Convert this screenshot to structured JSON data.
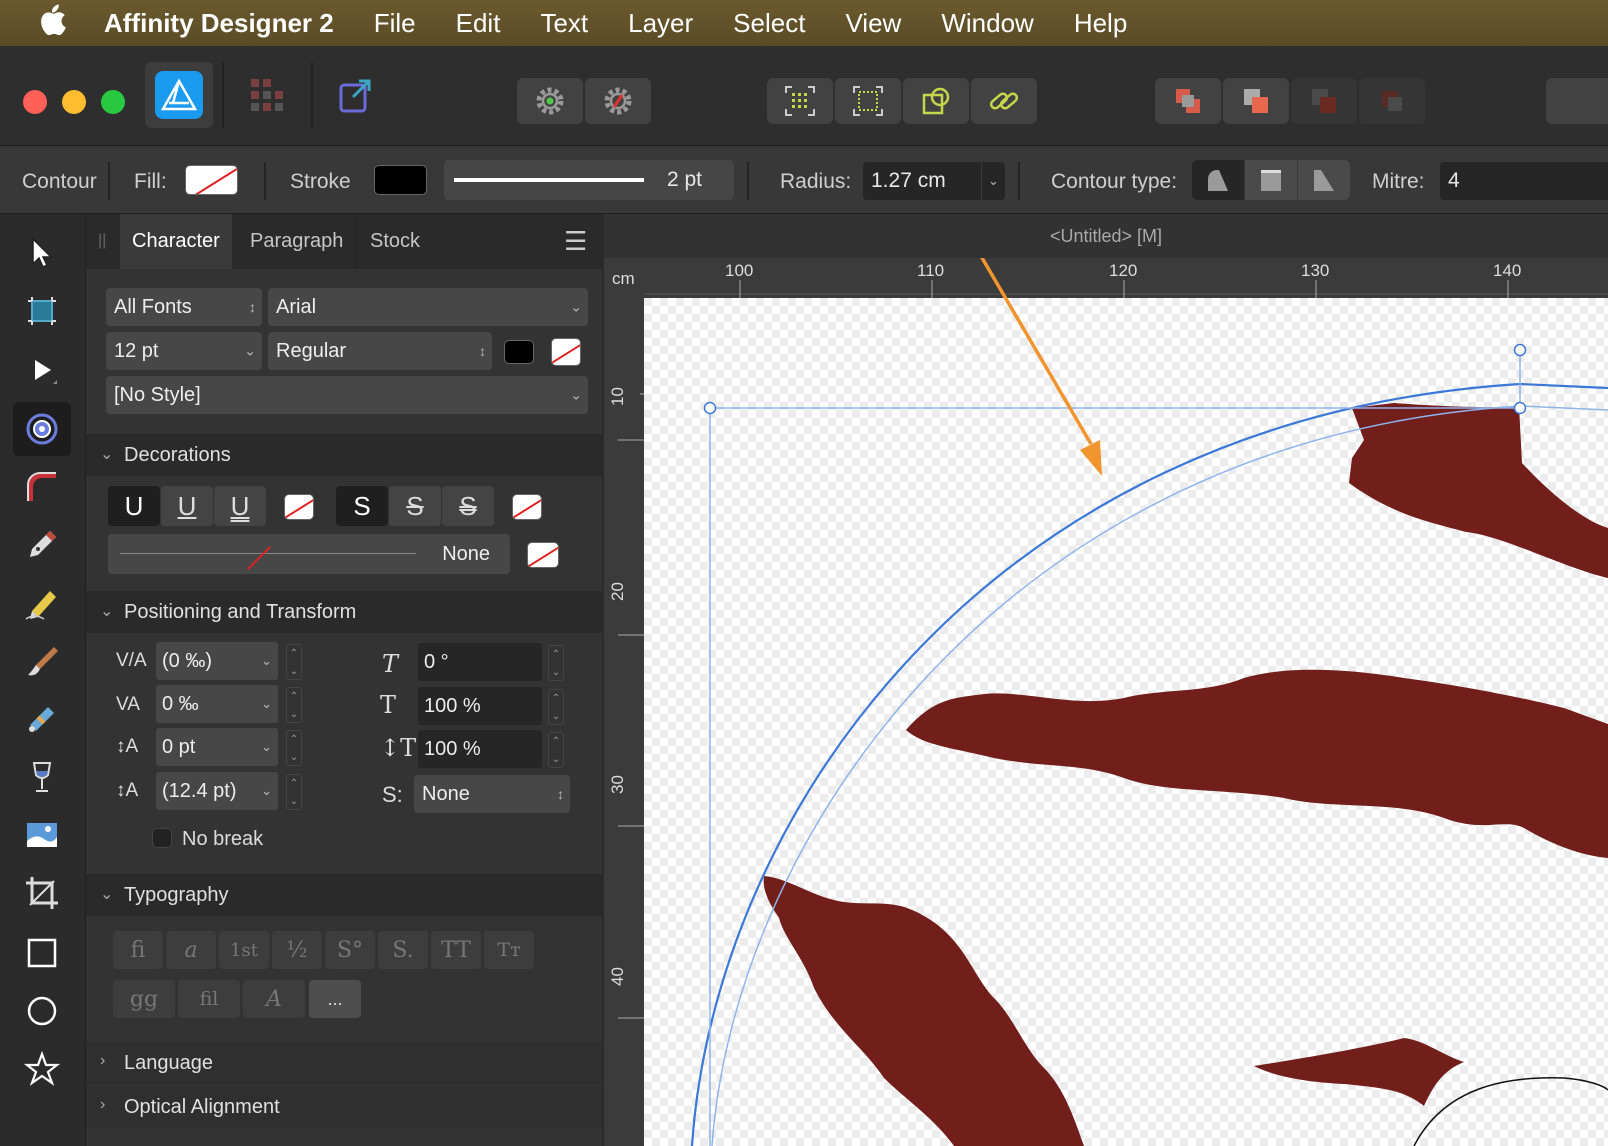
{
  "menubar": {
    "app_name": "Affinity Designer 2",
    "items": [
      "File",
      "Edit",
      "Text",
      "Layer",
      "Select",
      "View",
      "Window",
      "Help"
    ]
  },
  "context_toolbar": {
    "tool_label": "Contour",
    "fill_label": "Fill:",
    "stroke_label": "Stroke",
    "stroke_width": "2 pt",
    "radius_label": "Radius:",
    "radius_value": "1.27 cm",
    "contour_type_label": "Contour type:",
    "mitre_label": "Mitre:",
    "mitre_value": "4"
  },
  "panel": {
    "tabs": [
      "Character",
      "Paragraph",
      "Stock"
    ],
    "font_collection": "All Fonts",
    "font_family": "Arial",
    "font_size": "12 pt",
    "font_style": "Regular",
    "style": "[No Style]",
    "decorations": {
      "title": "Decorations",
      "underline_glyph": "U",
      "strike_glyph": "S",
      "line_value": "None"
    },
    "positioning": {
      "title": "Positioning and Transform",
      "kerning": "(0 ‰)",
      "tracking": "0 ‰",
      "baseline": "0 pt",
      "leading": "(12.4 pt)",
      "shear": "0 °",
      "vertical_scale": "100 %",
      "horizontal_scale": "100 %",
      "position_value": "None",
      "no_break_label": "No break"
    },
    "typography": {
      "title": "Typography",
      "glyphs": [
        "fi",
        "a",
        "1st",
        "½",
        "S°",
        "S.",
        "TT",
        "Tт",
        "gg",
        "fil",
        "A",
        "..."
      ]
    },
    "collapsed_sections": [
      "Language",
      "Optical Alignment"
    ]
  },
  "document": {
    "title": "<Untitled> [M]",
    "ruler_unit": "cm",
    "ruler_x": [
      "100",
      "110",
      "120",
      "130",
      "140"
    ],
    "ruler_y": [
      "10",
      "20",
      "30",
      "40"
    ]
  },
  "colors": {
    "shape_fill": "#721e1b",
    "selection": "#3b78d8",
    "annotation_arrow": "#f0952e"
  }
}
